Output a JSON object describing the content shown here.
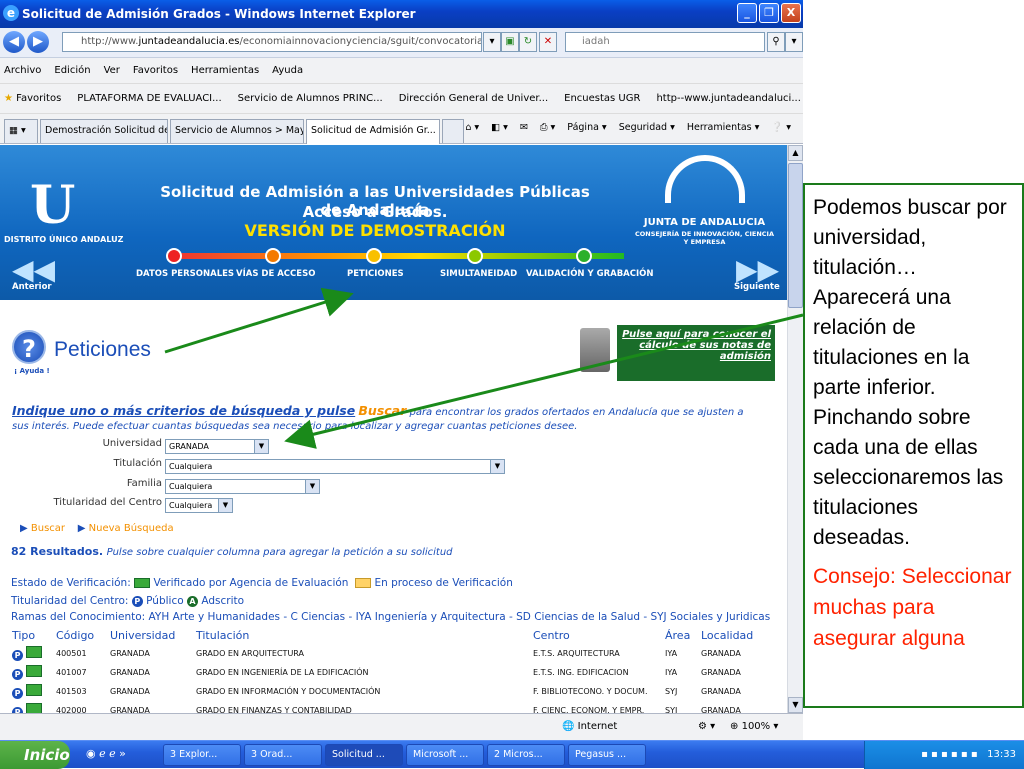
{
  "window": {
    "title": "Solicitud de Admisión Grados - Windows Internet Explorer",
    "minimize": "_",
    "restore": "❐",
    "close": "X"
  },
  "address": {
    "url_prefix": "http://www.",
    "url_host": "juntadeandalucia.es",
    "url_rest": "/economiainnovacionyciencia/sguit/convocatorias/GradosDemo/principal...",
    "search_text": "iadah"
  },
  "menu": [
    "Archivo",
    "Edición",
    "Ver",
    "Favoritos",
    "Herramientas",
    "Ayuda"
  ],
  "favorites": {
    "label": "Favoritos",
    "items": [
      "PLATAFORMA DE EVALUACI...",
      "Servicio de Alumnos PRINC...",
      "Dirección General de Univer...",
      "Encuestas UGR",
      "http--www.juntadeandaluci..."
    ]
  },
  "tabs": [
    "Demostración Solicitud de A...",
    "Servicio de Alumnos > May...",
    "Solicitud de Admisión Gr..."
  ],
  "tab_close": "X",
  "tools": [
    "Página ▾",
    "Seguridad ▾",
    "Herramientas ▾"
  ],
  "banner": {
    "district": "DISTRITO ÚNICO ANDALUZ",
    "title1": "Solicitud de Admisión a las Universidades Públicas de Andalucía",
    "title2": "Acceso a Grados.",
    "title3": "VERSIÓN DE DEMOSTRACIÓN",
    "steps": [
      "DATOS PERSONALES",
      "VÍAS DE ACCESO",
      "PETICIONES",
      "SIMULTANEIDAD",
      "VALIDACIÓN Y GRABACIÓN"
    ],
    "prev": "Anterior",
    "next": "Siguiente",
    "junta_name": "JUNTA DE ANDALUCIA",
    "junta_sub": "CONSEJERÍA DE INNOVACIÓN, CIENCIA Y EMPRESA"
  },
  "section": {
    "help": "¡ Ayuda !",
    "title": "Peticiones",
    "calc_link": "Pulse aquí para conocer el cálculo de sus notas de admisión",
    "instr_bold": "Indique uno o más criterios de búsqueda y pulse",
    "instr_buscar": "Buscar",
    "instr_rest": "para encontrar los grados ofertados en Andalucía que se ajusten a sus interés. Puede efectuar cuantas búsquedas sea necesario para localizar y agregar cuantas peticiones desee."
  },
  "filters": [
    {
      "label": "Universidad",
      "value": "GRANADA"
    },
    {
      "label": "Titulación",
      "value": "Cualquiera"
    },
    {
      "label": "Familia",
      "value": "Cualquiera"
    },
    {
      "label": "Titularidad del Centro",
      "value": "Cualquiera"
    }
  ],
  "actions": {
    "search": "Buscar",
    "new_search": "Nueva Búsqueda"
  },
  "results": {
    "count": "82 Resultados.",
    "hint": "Pulse sobre cualquier columna para agregar la petición a su solicitud"
  },
  "legend": {
    "verif_label": "Estado de Verificación:",
    "verif_green": "Verificado por Agencia de Evaluación",
    "verif_yellow": "En proceso de Verificación",
    "tit_label": "Titularidad del Centro:",
    "publico": "Público",
    "adscrito": "Adscrito",
    "ramas": "Ramas del Conocimiento: AYH Arte y Humanidades - C Ciencias - IYA Ingeniería y Arquitectura - SD Ciencias de la Salud - SYJ Sociales y Juridicas"
  },
  "table": {
    "headers": [
      "Tipo",
      "Código",
      "Universidad",
      "Titulación",
      "Centro",
      "Área",
      "Localidad"
    ],
    "rows": [
      {
        "codigo": "400501",
        "universidad": "GRANADA",
        "titulacion": "GRADO EN ARQUITECTURA",
        "centro": "E.T.S. ARQUITECTURA",
        "area": "IYA",
        "localidad": "GRANADA"
      },
      {
        "codigo": "401007",
        "universidad": "GRANADA",
        "titulacion": "GRADO EN INGENIERÍA DE LA EDIFICACIÓN",
        "centro": "E.T.S. ING. EDIFICACION",
        "area": "IYA",
        "localidad": "GRANADA"
      },
      {
        "codigo": "401503",
        "universidad": "GRANADA",
        "titulacion": "GRADO EN INFORMACIÓN Y DOCUMENTACIÓN",
        "centro": "F. BIBLIOTECONO. Y DOCUM.",
        "area": "SYJ",
        "localidad": "GRANADA"
      },
      {
        "codigo": "402000",
        "universidad": "GRANADA",
        "titulacion": "GRADO EN FINANZAS Y CONTABILIDAD",
        "centro": "F. CIENC. ECONOM. Y EMPR.",
        "area": "SYJ",
        "localidad": "GRANADA"
      }
    ],
    "tipo_letter": "P"
  },
  "statusbar": {
    "zone": "Internet",
    "zoom": "100%"
  },
  "note": {
    "main": "Podemos buscar por universidad, titulación… Aparecerá una relación de titulaciones en la parte inferior. Pinchando sobre cada una de ellas seleccionaremos las titulaciones deseadas.",
    "tip": "Consejo: Seleccionar muchas para asegurar alguna"
  },
  "taskbar": {
    "start": "Inicio",
    "buttons": [
      "3 Explor...",
      "3 Orad...",
      "Solicitud ...",
      "Microsoft ...",
      "2 Micros...",
      "Pegasus ..."
    ],
    "clock": "13:33"
  },
  "colors": {
    "accent_blue": "#1b4eb8",
    "green": "#1a6d2a",
    "orange": "#f39000",
    "tip_red": "#ff2200"
  }
}
